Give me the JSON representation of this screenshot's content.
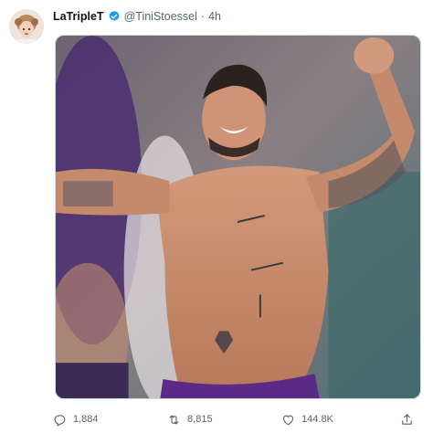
{
  "user": {
    "display_name": "LaTripleT",
    "handle": "@TiniStoessel",
    "separator": "·",
    "time": "4h",
    "verified": true
  },
  "media": {
    "image_icon": "photo-icon"
  },
  "actions": {
    "replies": "1,884",
    "retweets": "8,815",
    "likes": "144.8K"
  },
  "colors": {
    "verified_blue": "#1d9bf0",
    "muted_text": "#536471",
    "shorts_purple": "#5b2a86"
  },
  "icons": [
    "verified-badge-icon",
    "reply-icon",
    "retweet-icon",
    "like-icon",
    "share-icon"
  ]
}
